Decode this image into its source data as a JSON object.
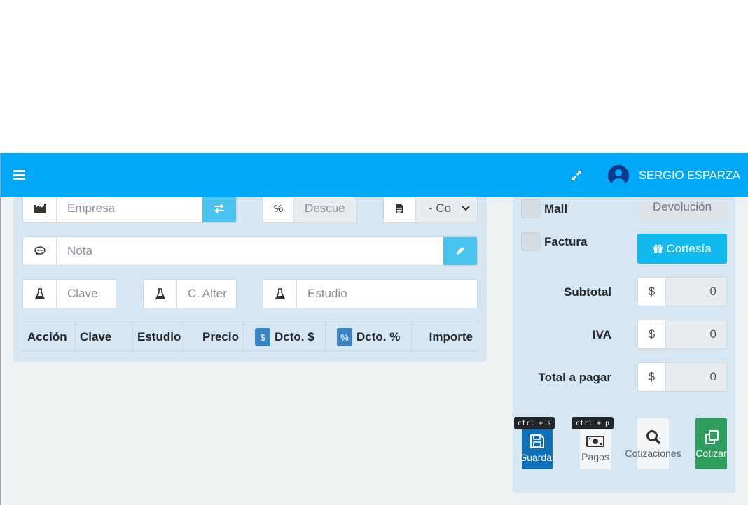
{
  "navbar": {
    "user_name": "SERGIO ESPARZA",
    "icons": [
      "hamburger-menu-icon",
      "fullscreen-expand-icon",
      "user-circle-icon"
    ]
  },
  "form": {
    "empresa_placeholder": "Empresa",
    "descuento_addon": "%",
    "descuento_placeholder": "Descue",
    "comprobante_value": "- Co",
    "nota_placeholder": "Nota",
    "clave_placeholder": "Clave",
    "clave_alterna_placeholder": "C. Alter",
    "estudio_placeholder": "Estudio"
  },
  "table": {
    "columns": [
      "Acción",
      "Clave",
      "Estudio",
      "Precio",
      "Dcto. $",
      "Dcto. %",
      "Importe"
    ],
    "badges": {
      "dcto_monto": "$",
      "dcto_porcentaje": "%"
    }
  },
  "options": {
    "mail_label": "Mail",
    "factura_label": "Factura",
    "devolucion_label": "Devolución",
    "cortesia_label": "Cortesía"
  },
  "totals": {
    "currency": "$",
    "subtotal_label": "Subtotal",
    "subtotal_value": "0",
    "iva_label": "IVA",
    "iva_value": "0",
    "total_label": "Total a pagar",
    "total_value": "0"
  },
  "actions": {
    "guardar_label": "Guardar",
    "guardar_shortcut": "ctrl + s",
    "pagos_label": "Pagos",
    "pagos_shortcut": "ctrl + p",
    "cotizaciones_label": "Cotizaciones",
    "cotizar_label": "Cotizar"
  },
  "colors": {
    "navbar": "#00a8f7",
    "panel": "#d6e6f3",
    "guardar": "#0f6fb8",
    "cotizar": "#2e9e5f",
    "cortesia": "#12b9ee"
  }
}
